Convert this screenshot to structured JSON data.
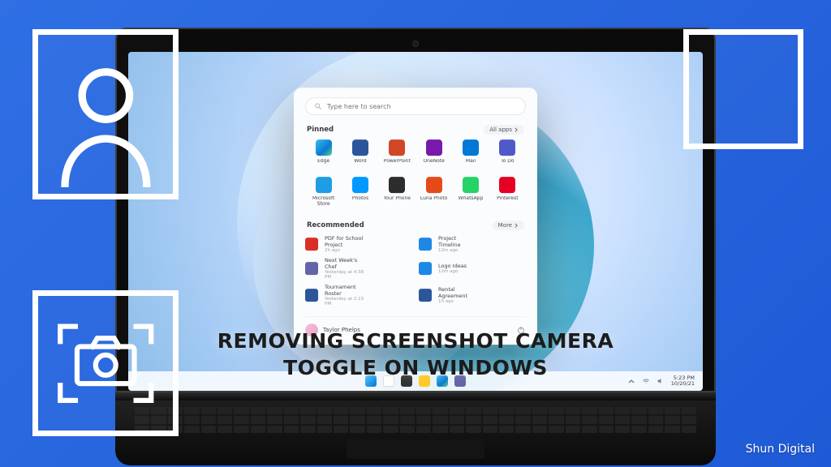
{
  "title_line1": "REMOVING SCREENSHOT CAMERA",
  "title_line2": "TOGGLE ON WINDOWS",
  "brand": "Shun Digital",
  "search_placeholder": "Type here to search",
  "section_pinned": "Pinned",
  "pill_allapps": "All apps",
  "section_recommended": "Recommended",
  "pill_more": "More",
  "apps_row1": [
    {
      "label": "Edge",
      "cls": "c-edge"
    },
    {
      "label": "Word",
      "cls": "c-word"
    },
    {
      "label": "PowerPoint",
      "cls": "c-ppt"
    },
    {
      "label": "OneNote",
      "cls": "c-onen"
    },
    {
      "label": "Mail",
      "cls": "c-mail"
    },
    {
      "label": "To Do",
      "cls": "c-todo"
    }
  ],
  "apps_row2": [
    {
      "label": "Microsoft Store",
      "cls": "c-store"
    },
    {
      "label": "Photos",
      "cls": "c-photo"
    },
    {
      "label": "Your Phone",
      "cls": "c-yp"
    },
    {
      "label": "Luna Photo",
      "cls": "c-lphoto"
    },
    {
      "label": "WhatsApp",
      "cls": "c-wa"
    },
    {
      "label": "Pinterest",
      "cls": "c-pin"
    }
  ],
  "recommended": [
    {
      "title": "PDF for School Project",
      "sub": "2h ago",
      "cls": "c-pdf",
      "title2": "Project Timeline",
      "sub2": "12m ago",
      "cls2": "c-link"
    },
    {
      "title": "Next Week's Chef",
      "sub": "Yesterday at 4:38 PM",
      "cls": "c-teams",
      "title2": "Logo Ideas",
      "sub2": "12m ago",
      "cls2": "c-link"
    },
    {
      "title": "Tournament Roster",
      "sub": "Yesterday at 2:23 PM",
      "cls": "c-docx",
      "title2": "Rental Agreement",
      "sub2": "1h ago",
      "cls2": "c-docx"
    }
  ],
  "user_name": "Taylor Phelps",
  "clock_time": "5:23 PM",
  "clock_date": "10/20/21"
}
